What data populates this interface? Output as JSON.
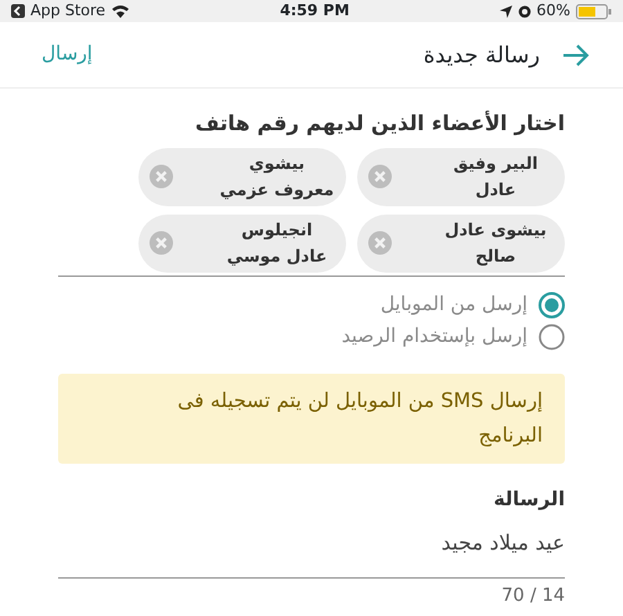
{
  "status_bar": {
    "back_label": "App Store",
    "time": "4:59 PM",
    "battery": "60%"
  },
  "header": {
    "title": "رسالة جديدة",
    "send": "إرسال"
  },
  "recipients": {
    "heading": "اختار الأعضاء الذين لديهم رقم هاتف",
    "chips": [
      {
        "name": "البير وفيق عادل"
      },
      {
        "name": "بيشوي معروف عزمي"
      },
      {
        "name": "بيشوى عادل صالح"
      },
      {
        "name": "انجيلوس عادل موسي"
      }
    ]
  },
  "send_options": [
    {
      "label": "إرسل من الموبايل",
      "selected": true
    },
    {
      "label": "إرسل بإستخدام الرصيد",
      "selected": false
    }
  ],
  "notice": "إرسال SMS من الموبايل لن يتم تسجيله فى البرنامج",
  "message": {
    "label": "الرسالة",
    "value": "عيد ميلاد مجيد",
    "counter": "70 / 14"
  }
}
